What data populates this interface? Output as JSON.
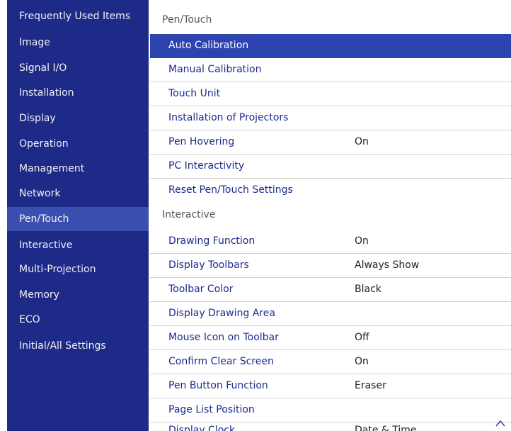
{
  "sidebar": {
    "items": [
      {
        "label": "Frequently Used Items"
      },
      {
        "label": "Image"
      },
      {
        "label": "Signal I/O"
      },
      {
        "label": "Installation"
      },
      {
        "label": "Display"
      },
      {
        "label": "Operation"
      },
      {
        "label": "Management"
      },
      {
        "label": "Network"
      },
      {
        "label": "Pen/Touch",
        "active": true
      },
      {
        "label": "Interactive"
      },
      {
        "label": "Multi-Projection"
      },
      {
        "label": "Memory"
      },
      {
        "label": "ECO"
      },
      {
        "label": "Initial/All Settings"
      }
    ]
  },
  "main": {
    "section1": {
      "header": "Pen/Touch",
      "rows": [
        {
          "label": "Auto Calibration",
          "value": "",
          "selected": true
        },
        {
          "label": "Manual Calibration",
          "value": ""
        },
        {
          "label": "Touch Unit",
          "value": ""
        },
        {
          "label": "Installation of Projectors",
          "value": ""
        },
        {
          "label": "Pen Hovering",
          "value": "On"
        },
        {
          "label": "PC Interactivity",
          "value": ""
        },
        {
          "label": "Reset Pen/Touch Settings",
          "value": ""
        }
      ]
    },
    "section2": {
      "header": "Interactive",
      "rows": [
        {
          "label": "Drawing Function",
          "value": "On"
        },
        {
          "label": "Display Toolbars",
          "value": "Always Show"
        },
        {
          "label": "Toolbar Color",
          "value": "Black"
        },
        {
          "label": "Display Drawing Area",
          "value": ""
        },
        {
          "label": "Mouse Icon on Toolbar",
          "value": "Off"
        },
        {
          "label": "Confirm Clear Screen",
          "value": "On"
        },
        {
          "label": "Pen Button Function",
          "value": "Eraser"
        },
        {
          "label": "Page List Position",
          "value": ""
        },
        {
          "label": "Display Clock",
          "value": "Date & Time"
        }
      ]
    }
  },
  "scroll_up_icon": "chevron-up-icon",
  "colors": {
    "sidebar_bg": "#1e2a88",
    "sidebar_active": "#3a4fb0",
    "selected_row": "#2d43b0",
    "menu_text": "#1c2b8c"
  }
}
